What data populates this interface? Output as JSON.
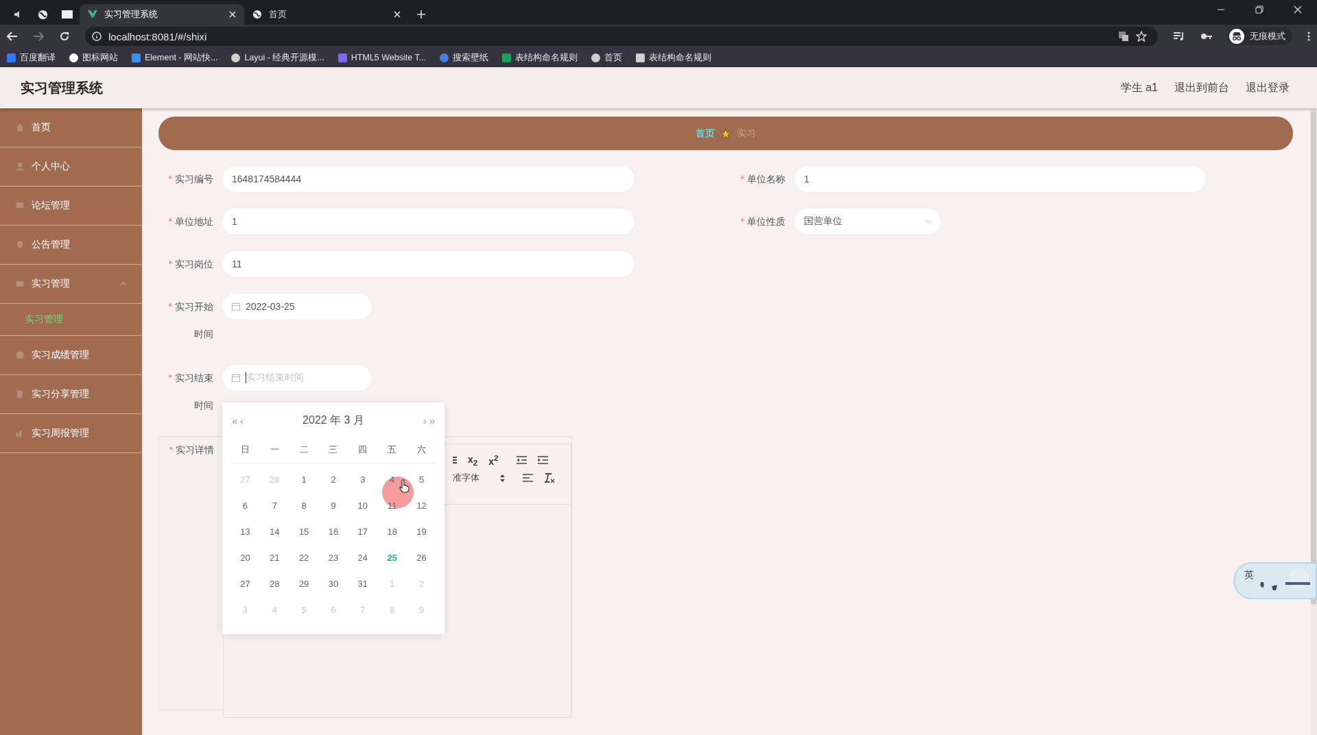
{
  "browser": {
    "tabs": [
      {
        "title": "实习管理系统",
        "selected": true
      },
      {
        "title": "首页",
        "selected": false
      }
    ],
    "url": "localhost:8081/#/shixi",
    "profile": "无痕模式",
    "bookmarks": [
      "百度翻译",
      "图标网站",
      "Element - 网站快...",
      "Layui - 经典开源模...",
      "HTML5 Website T...",
      "搜索壁纸",
      "表结构命名规则",
      "首页",
      "表结构命名规则"
    ]
  },
  "header": {
    "title": "实习管理系统",
    "links": [
      "学生 a1",
      "退出到前台",
      "退出登录"
    ]
  },
  "sidebar": {
    "items": [
      {
        "label": "首页",
        "selected": false
      },
      {
        "label": "个人中心",
        "selected": false
      },
      {
        "label": "论坛管理",
        "selected": false
      },
      {
        "label": "公告管理",
        "selected": false
      },
      {
        "label": "实习管理",
        "selected": false,
        "expanded": true,
        "children": [
          {
            "label": "实习管理",
            "selected": true
          }
        ]
      },
      {
        "label": "实习成绩管理",
        "selected": false
      },
      {
        "label": "实习分享管理",
        "selected": false
      },
      {
        "label": "实习周报管理",
        "selected": false
      }
    ]
  },
  "breadcrumb": [
    "首页",
    "实习"
  ],
  "form": {
    "required_mark": "*",
    "left": [
      {
        "kind": "text",
        "label": "实习编号",
        "required": true,
        "value": "1648174584444"
      },
      {
        "kind": "text",
        "label": "单位地址",
        "required": true,
        "value": "1"
      },
      {
        "kind": "text",
        "label": "实习岗位",
        "required": true,
        "value": "11"
      },
      {
        "kind": "date",
        "label": "实习开始时间",
        "required": true,
        "value": "2022-03-25"
      },
      {
        "kind": "date",
        "label": "实习结束时间",
        "required": true,
        "placeholder": "实习结束时间",
        "focused": true
      },
      {
        "kind": "editor",
        "label": "实习详情",
        "required": true
      }
    ],
    "right": [
      {
        "kind": "text",
        "label": "单位名称",
        "required": true,
        "value": "1"
      },
      {
        "kind": "select",
        "label": "单位性质",
        "required": true,
        "value": "国营单位"
      }
    ]
  },
  "editor_toolbar": {
    "script_buttons": [
      "x$_{2}$",
      "x$^{2}$"
    ],
    "font": "准字体"
  },
  "calendar": {
    "title": "2022 年 3 月",
    "prev_year": "«",
    "prev_month": "‹",
    "next_month": "›",
    "next_year": "»",
    "weekdays": [
      "日",
      "一",
      "二",
      "三",
      "四",
      "五",
      "六"
    ],
    "days": [
      {
        "label": "27",
        "muted": true,
        "today": false
      },
      {
        "label": "28",
        "muted": true,
        "today": false
      },
      {
        "label": "1",
        "muted": false,
        "today": false
      },
      {
        "label": "2",
        "muted": false,
        "today": false
      },
      {
        "label": "3",
        "muted": false,
        "today": false
      },
      {
        "label": "4",
        "muted": false,
        "today": false
      },
      {
        "label": "5",
        "muted": false,
        "today": false
      },
      {
        "label": "6",
        "muted": false,
        "today": false
      },
      {
        "label": "7",
        "muted": false,
        "today": false
      },
      {
        "label": "8",
        "muted": false,
        "today": false
      },
      {
        "label": "9",
        "muted": false,
        "today": false
      },
      {
        "label": "10",
        "muted": false,
        "today": false
      },
      {
        "label": "11",
        "muted": false,
        "today": false
      },
      {
        "label": "12",
        "muted": false,
        "today": false
      },
      {
        "label": "13",
        "muted": false,
        "today": false
      },
      {
        "label": "14",
        "muted": false,
        "today": false
      },
      {
        "label": "15",
        "muted": false,
        "today": false
      },
      {
        "label": "16",
        "muted": false,
        "today": false
      },
      {
        "label": "17",
        "muted": false,
        "today": false
      },
      {
        "label": "18",
        "muted": false,
        "today": false
      },
      {
        "label": "19",
        "muted": false,
        "today": false
      },
      {
        "label": "20",
        "muted": false,
        "today": false
      },
      {
        "label": "21",
        "muted": false,
        "today": false
      },
      {
        "label": "22",
        "muted": false,
        "today": false
      },
      {
        "label": "23",
        "muted": false,
        "today": false
      },
      {
        "label": "24",
        "muted": false,
        "today": false
      },
      {
        "label": "25",
        "muted": false,
        "today": true
      },
      {
        "label": "26",
        "muted": false,
        "today": false
      },
      {
        "label": "27",
        "muted": false,
        "today": false
      },
      {
        "label": "28",
        "muted": false,
        "today": false
      },
      {
        "label": "29",
        "muted": false,
        "today": false
      },
      {
        "label": "30",
        "muted": false,
        "today": false
      },
      {
        "label": "31",
        "muted": false,
        "today": false
      },
      {
        "label": "1",
        "muted": true,
        "today": false
      },
      {
        "label": "2",
        "muted": true,
        "today": false
      },
      {
        "label": "3",
        "muted": true,
        "today": false
      },
      {
        "label": "4",
        "muted": true,
        "today": false
      },
      {
        "label": "5",
        "muted": true,
        "today": false
      },
      {
        "label": "6",
        "muted": true,
        "today": false
      },
      {
        "label": "7",
        "muted": true,
        "today": false
      },
      {
        "label": "8",
        "muted": true,
        "today": false
      },
      {
        "label": "9",
        "muted": true,
        "today": false
      }
    ]
  },
  "ime": {
    "mode": "英"
  }
}
